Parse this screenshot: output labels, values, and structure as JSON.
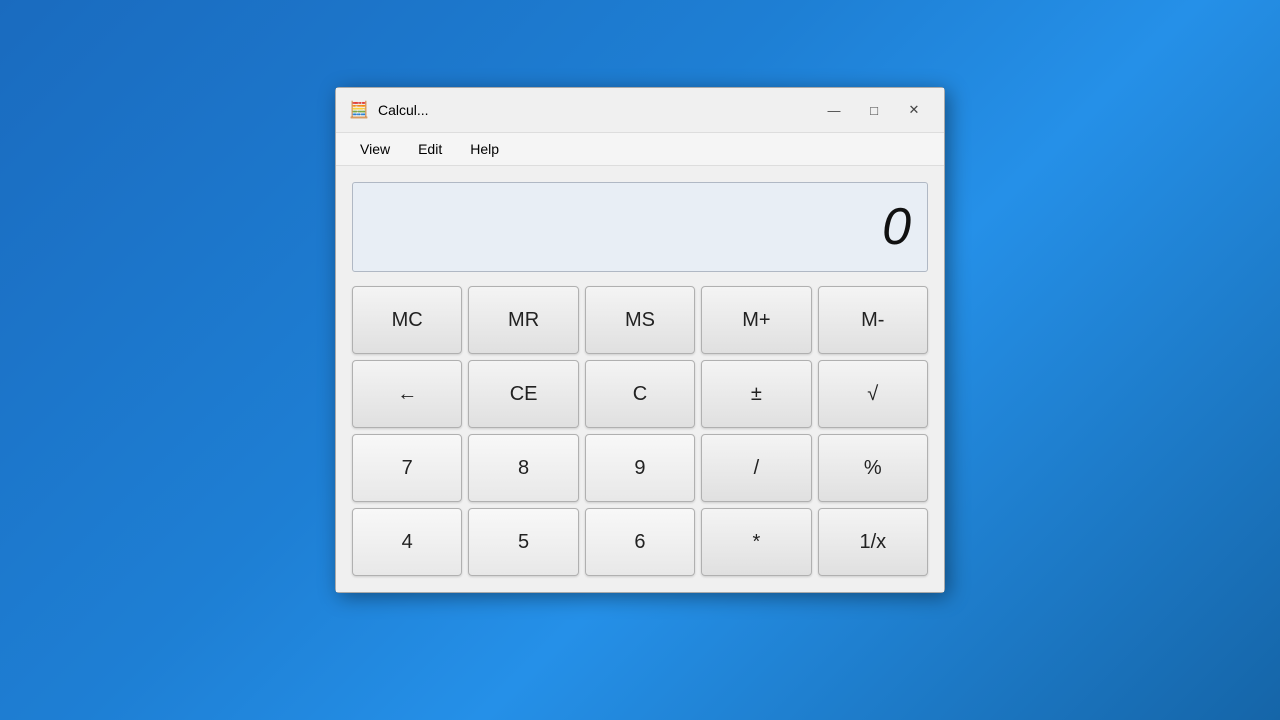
{
  "window": {
    "title": "Calcul...",
    "icon": "🧮"
  },
  "controls": {
    "minimize": "—",
    "maximize": "□",
    "close": "✕"
  },
  "menu": {
    "items": [
      "View",
      "Edit",
      "Help"
    ]
  },
  "display": {
    "value": "0"
  },
  "buttons": {
    "memory_row": [
      "MC",
      "MR",
      "MS",
      "M+",
      "M-"
    ],
    "ops_row": [
      "←",
      "CE",
      "C",
      "±",
      "√"
    ],
    "row1": [
      "7",
      "8",
      "9",
      "/",
      "%"
    ],
    "row2": [
      "4",
      "5",
      "6",
      "*",
      "1/x"
    ]
  }
}
